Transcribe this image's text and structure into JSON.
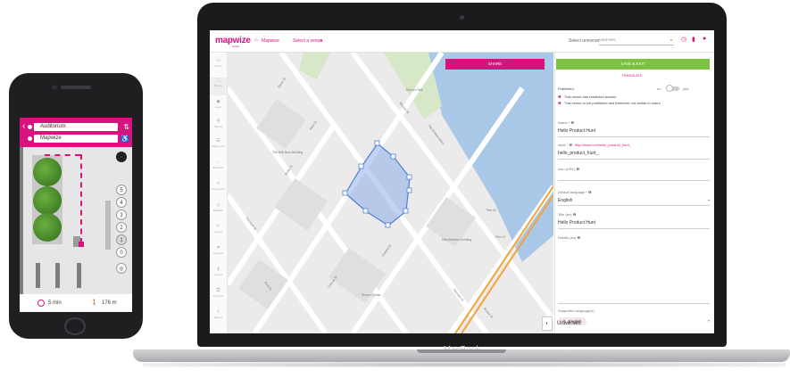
{
  "phone": {
    "from_field": "Auditorium",
    "to_field": "Mapwize",
    "floor_buttons": [
      "5",
      "4",
      "3",
      "2",
      "1",
      "0"
    ],
    "route_time": "5 min",
    "route_distance": "176 m"
  },
  "laptop": {
    "brand": "MacBook",
    "app": {
      "logo": "mapwize",
      "logo_sub": "studio",
      "breadcrumb": {
        "root": "Mapwize",
        "venue_selector": "Select a venue"
      },
      "universe": {
        "label": "Select universe:",
        "value": "VISITORS"
      },
      "sidebar": [
        "Venue",
        "Places",
        "Layer",
        "Places",
        "Place Lists",
        "Beacons",
        "Connectors",
        "Modules",
        "Layers",
        "Universe",
        "Access",
        "API keys",
        "Export"
      ],
      "map": {
        "share_button": "SHARE",
        "zoom_control": "◐",
        "street_labels": [
          "Spear St",
          "Main St",
          "Beale St",
          "Howard St",
          "Folsom St",
          "The Embarcadero",
          "Harrison St",
          "Bryant St",
          "Fremont St",
          "First St",
          "Mission St"
        ],
        "poi_labels": [
          "Rincon Park",
          "Pier 14",
          "Pier 22",
          "The Hills Bros Building",
          "Hills Brothers Building",
          "Rincon Center"
        ]
      },
      "panel": {
        "save_button": "SAVE & EXIT",
        "translate_link": "TRANSLATE",
        "published_label": "Published",
        "toggle_off": "no",
        "toggle_on": "yes",
        "warning_restricted": "This venue has restricted access",
        "warning_unpublished": "This venue is not published and therefore not visible to users",
        "name_label": "Name * ❶",
        "name_value": "Hello Product Hunt",
        "alias_label": "Alias * ❶",
        "alias_link": "http://mwz.io/v/hello_product_hunt_",
        "alias_value": "hello_product_hunt_",
        "icon_label": "Icon (URL) ❶",
        "default_language_label": "Default language * ❶",
        "default_language_value": "English",
        "title_label": "Title (en) ❶",
        "title_value": "Hello Product Hunt",
        "details_label": "Details (en) ❶",
        "supported_languages_label": "Supported language(s)",
        "supported_language_chip": "English",
        "universes_heading": "Universes"
      }
    }
  },
  "colors": {
    "brand": "#d9137e",
    "save": "#7cc142",
    "water": "#a9c8e8",
    "route": "#f2a33a"
  }
}
